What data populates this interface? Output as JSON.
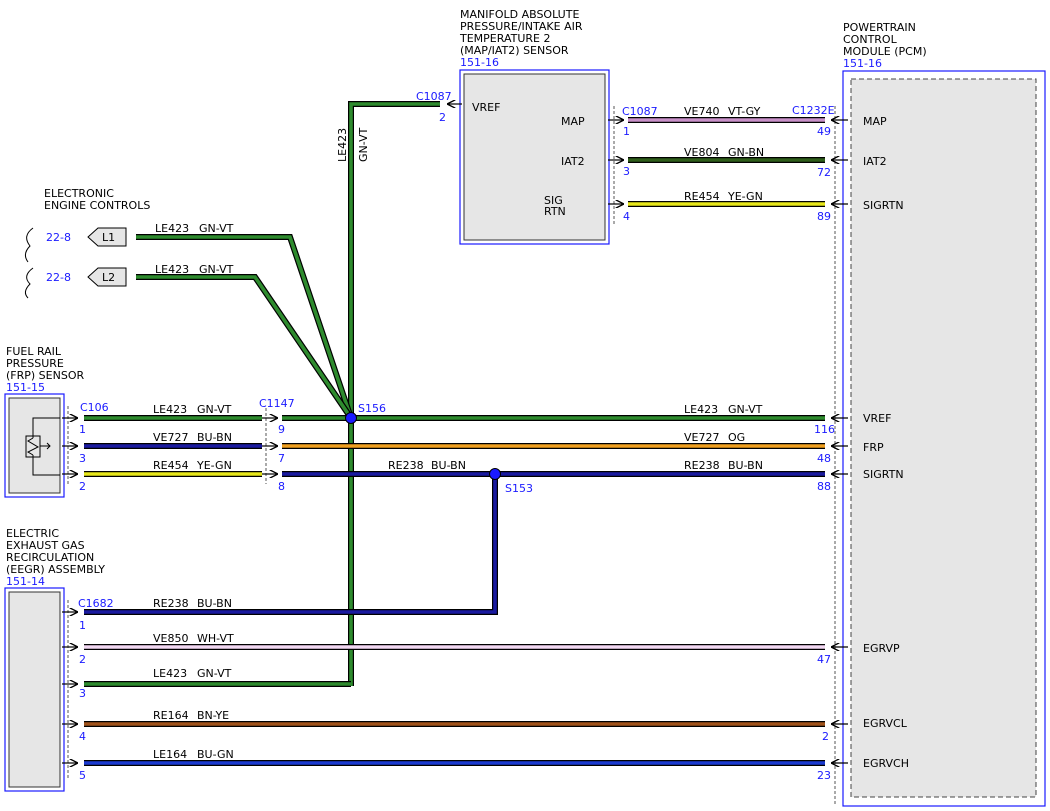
{
  "components": {
    "map_sensor": {
      "title": [
        "MANIFOLD ABSOLUTE",
        "PRESSURE/INTAKE AIR",
        "TEMPERATURE 2",
        "(MAP/IAT2) SENSOR"
      ],
      "ref": "151-16",
      "pins": {
        "vref": "VREF",
        "map": "MAP",
        "iat2": "IAT2",
        "sig": "SIG",
        "rtn": "RTN"
      }
    },
    "pcm": {
      "title": [
        "POWERTRAIN",
        "CONTROL",
        "MODULE (PCM)"
      ],
      "ref": "151-16",
      "pins": [
        "MAP",
        "IAT2",
        "SIGRTN",
        "VREF",
        "FRP",
        "SIGRTN",
        "EGRVP",
        "EGRVCL",
        "EGRVCH"
      ]
    },
    "eec": {
      "title": [
        "ELECTRONIC",
        "ENGINE CONTROLS"
      ],
      "refs": [
        "22-8",
        "22-8"
      ],
      "flags": [
        "L1",
        "L2"
      ]
    },
    "frp": {
      "title": [
        "FUEL RAIL",
        "PRESSURE",
        "(FRP) SENSOR"
      ],
      "ref": "151-15"
    },
    "eegr": {
      "title": [
        "ELECTRIC",
        "EXHAUST GAS",
        "RECIRCULATION",
        "(EEGR) ASSEMBLY"
      ],
      "ref": "151-14"
    }
  },
  "connectors": {
    "c1087_vref": "C1087",
    "c1087_vref_pin": "2",
    "c1087": "C1087",
    "c1087_pins": [
      "1",
      "3",
      "4"
    ],
    "c1232e": "C1232E",
    "pcm_pins_top": [
      "49",
      "72",
      "89"
    ],
    "c106": "C106",
    "c106_pins": [
      "1",
      "3",
      "2"
    ],
    "c1147": "C1147",
    "c1147_pins": [
      "9",
      "7",
      "8"
    ],
    "pcm_pins_mid": [
      "116",
      "48",
      "88"
    ],
    "c1682": "C1682",
    "c1682_pins": [
      "1",
      "2",
      "3",
      "4",
      "5"
    ],
    "pcm_pins_bot": [
      "47",
      "2",
      "23"
    ]
  },
  "splices": {
    "s156": "S156",
    "s153": "S153"
  },
  "wires": {
    "vertical": {
      "circuit": "LE423",
      "color": "GN-VT"
    },
    "ve740": {
      "circuit": "VE740",
      "color": "VT-GY"
    },
    "ve804": {
      "circuit": "VE804",
      "color": "GN-BN"
    },
    "re454_top": {
      "circuit": "RE454",
      "color": "YE-GN"
    },
    "l1": {
      "circuit": "LE423",
      "color": "GN-VT"
    },
    "l2": {
      "circuit": "LE423",
      "color": "GN-VT"
    },
    "frp_vref": {
      "circuit": "LE423",
      "color": "GN-VT"
    },
    "frp_sig": {
      "circuit": "VE727",
      "color": "BU-BN"
    },
    "frp_rtn": {
      "circuit": "RE454",
      "color": "YE-GN"
    },
    "pcm_vref": {
      "circuit": "LE423",
      "color": "GN-VT"
    },
    "pcm_frp": {
      "circuit": "VE727",
      "color": "OG"
    },
    "re238_mid": {
      "circuit": "RE238",
      "color": "BU-BN"
    },
    "re238_pcm": {
      "circuit": "RE238",
      "color": "BU-BN"
    },
    "egr1": {
      "circuit": "RE238",
      "color": "BU-BN"
    },
    "egr2": {
      "circuit": "VE850",
      "color": "WH-VT"
    },
    "egr3": {
      "circuit": "LE423",
      "color": "GN-VT"
    },
    "egr4": {
      "circuit": "RE164",
      "color": "BN-YE"
    },
    "egr5": {
      "circuit": "LE164",
      "color": "BU-GN"
    }
  },
  "colors": {
    "label_blue": "#1a1aff",
    "GN-VT": "#2e8b2e",
    "VT-GY": "#c890c8",
    "GN-BN": "#2f5e1a",
    "YE-GN": "#e6e61a",
    "BU-BN": "#1a1aa0",
    "OG": "#f0a020",
    "WH-VT": "#f2d8f2",
    "BN-YE": "#a0521a",
    "BU-GN": "#1a3ad0"
  }
}
